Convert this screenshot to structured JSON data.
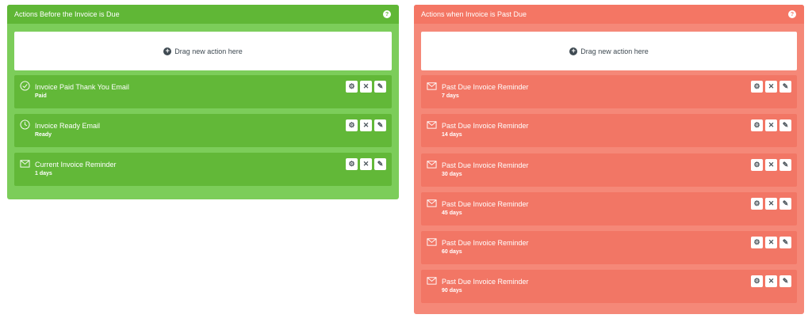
{
  "before_panel": {
    "title": "Actions Before the Invoice is Due",
    "help": "?",
    "dropzone": "Drag new action here",
    "actions": [
      {
        "icon": "check-circle-icon",
        "title": "Invoice Paid Thank You Email",
        "sub": "Paid"
      },
      {
        "icon": "clock-circle-icon",
        "title": "Invoice Ready Email",
        "sub": "Ready"
      },
      {
        "icon": "envelope-icon",
        "title": "Current Invoice Reminder",
        "sub": "1 days"
      }
    ]
  },
  "after_panel": {
    "title": "Actions when Invoice is Past Due",
    "help": "?",
    "dropzone": "Drag new action here",
    "actions": [
      {
        "icon": "envelope-icon",
        "title": "Past Due Invoice Reminder",
        "sub": "7 days"
      },
      {
        "icon": "envelope-icon",
        "title": "Past Due Invoice Reminder",
        "sub": "14 days"
      },
      {
        "icon": "envelope-icon",
        "title": "Past Due Invoice Reminder",
        "sub": "30 days"
      },
      {
        "icon": "envelope-icon",
        "title": "Past Due Invoice Reminder",
        "sub": "45 days"
      },
      {
        "icon": "envelope-icon",
        "title": "Past Due Invoice Reminder",
        "sub": "60 days"
      },
      {
        "icon": "envelope-icon",
        "title": "Past Due Invoice Reminder",
        "sub": "90 days"
      }
    ]
  },
  "colors": {
    "green_panel": "#7ccd5a",
    "green_header": "#60b736",
    "red_panel": "#f58878",
    "red_header": "#f47664"
  },
  "button_icons": [
    "gear-icon",
    "close-icon",
    "pencil-icon"
  ]
}
